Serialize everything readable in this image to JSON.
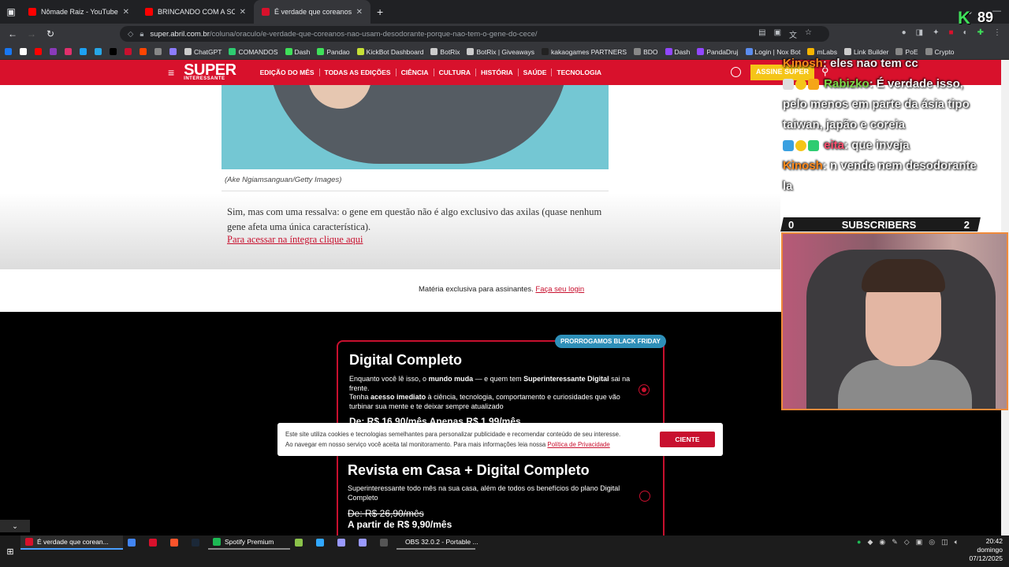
{
  "browser": {
    "tabs": [
      {
        "title": "Nômade Raiz - YouTube",
        "color": "#ff0000"
      },
      {
        "title": "BRINCANDO COM A SORTE N",
        "color": "#ff0000"
      },
      {
        "title": "É verdade que coreanos não us",
        "color": "#d8112c"
      }
    ],
    "url_domain": "super.abril.com.br",
    "url_path": "/coluna/oraculo/e-verdade-que-coreanos-nao-usam-desodorante-porque-nao-tem-o-gene-do-cece/",
    "bookmarks": [
      {
        "label": "",
        "color": "#1877f2"
      },
      {
        "label": "",
        "color": "#ffffff"
      },
      {
        "label": "",
        "color": "#ff0000"
      },
      {
        "label": "",
        "color": "#8a3ab9"
      },
      {
        "label": "",
        "color": "#e1306c"
      },
      {
        "label": "",
        "color": "#1da1f2"
      },
      {
        "label": "",
        "color": "#27a7e7"
      },
      {
        "label": "",
        "color": "#000000"
      },
      {
        "label": "",
        "color": "#c8102e"
      },
      {
        "label": "",
        "color": "#ff4500"
      },
      {
        "label": "",
        "color": "#888888"
      },
      {
        "label": "",
        "color": "#8c7cff"
      },
      {
        "label": "ChatGPT",
        "color": "#cccccc"
      },
      {
        "label": "COMANDOS",
        "color": "#2ecc71"
      },
      {
        "label": "Dash",
        "color": "#3fe05a"
      },
      {
        "label": "Pandao",
        "color": "#3fe05a"
      },
      {
        "label": "KickBot Dashboard",
        "color": "#c6e036"
      },
      {
        "label": "BotRix",
        "color": "#cccccc"
      },
      {
        "label": "BotRix | Giveaways",
        "color": "#cccccc"
      },
      {
        "label": "kakaogames PARTNERS",
        "color": "#222222"
      },
      {
        "label": "BDO",
        "color": "#888888"
      },
      {
        "label": "Dash",
        "color": "#9147ff"
      },
      {
        "label": "PandaDruj",
        "color": "#9147ff"
      },
      {
        "label": "Login | Nox Bot",
        "color": "#5b8def"
      },
      {
        "label": "mLabs",
        "color": "#f7b500"
      },
      {
        "label": "Link Builder",
        "color": "#cccccc"
      },
      {
        "label": "PoE",
        "color": "#888888"
      },
      {
        "label": "Crypto",
        "color": "#888888"
      }
    ]
  },
  "site": {
    "logo": "SUPER",
    "logo_sub": "INTERESSANTE",
    "menu": [
      "EDIÇÃO DO MÊS",
      "TODAS AS EDIÇÕES",
      "CIÊNCIA",
      "CULTURA",
      "HISTÓRIA",
      "SAÚDE",
      "TECNOLOGIA"
    ],
    "cta": "ASSINE SUPER"
  },
  "article": {
    "caption": "(Ake Ngiamsanguan/Getty Images)",
    "body": "Sim, mas com uma ressalva: o gene em questão não é algo exclusivo das axilas (quase nenhum gene afeta uma única característica).",
    "link": "Para acessar na íntegra clique aqui",
    "exclusive_text": "Matéria exclusiva para assinantes.",
    "login_link": "Faça seu login"
  },
  "paywall": {
    "badge": "PRORROGAMOS BLACK FRIDAY",
    "plan1": {
      "title": "Digital Completo",
      "line1_a": "Enquanto você lê isso, o ",
      "line1_b": "mundo muda",
      "line1_c": " — e quem tem ",
      "line1_d": "Superinteressante Digital",
      "line1_e": " sai na frente.",
      "line2_a": "Tenha ",
      "line2_b": "acesso imediato",
      "line2_c": " à ciência, tecnologia, comportamento e curiosidades que vão turbinar sua mente e te deixar sempre atualizado",
      "price": "De: R$ 16,90/mês Apenas R$ 1,99/mês",
      "selected": true
    },
    "plan2": {
      "title": "Revista em Casa + Digital Completo",
      "desc": "Superinteressante todo mês na sua casa, além de todos os benefícios do plano Digital Completo",
      "price_old": "De: R$ 26,90/mês",
      "price_new": "A partir de R$ 9,90/mês",
      "selected": false
    }
  },
  "cookie": {
    "text1": "Este site utiliza cookies e tecnologias semelhantes para personalizar publicidade e recomendar conteúdo de seu interesse.",
    "text2": "Ao navegar em nosso serviço você aceita tal monitoramento. Para mais informações leia nossa ",
    "policy_link": "Política de Privacidade",
    "button": "CIENTE"
  },
  "stream": {
    "chat": [
      {
        "name": "Kinosh",
        "msg": ": eles nao tem cc"
      },
      {
        "name": "Rabizko",
        "msg": ": É verdade isso, pelo menos em parte da ásia tipo taiwan, japão e coreia"
      },
      {
        "name": "eita",
        "msg": ": que inveja"
      },
      {
        "name": "Kinosh",
        "msg": ": n vende nem desodorante la"
      }
    ],
    "subs_left": "0",
    "subs_label": "SUBSCRIBERS",
    "subs_right": "2",
    "overlay_k": "K",
    "overlay_num": "89"
  },
  "taskbar": {
    "apps": [
      {
        "label": "É verdade que corean...",
        "color": "#d8112c"
      },
      {
        "label": "",
        "color": "#4285f4"
      },
      {
        "label": "",
        "color": "#d8112c"
      },
      {
        "label": "",
        "color": "#fb542b"
      },
      {
        "label": "",
        "color": "#1b2838"
      },
      {
        "label": "Spotify Premium",
        "color": "#1db954"
      },
      {
        "label": "",
        "color": "#8bc34a"
      },
      {
        "label": "",
        "color": "#31a8ff"
      },
      {
        "label": "",
        "color": "#9999ff"
      },
      {
        "label": "",
        "color": "#9999ff"
      },
      {
        "label": "",
        "color": "#555555"
      },
      {
        "label": "OBS 32.0.2 - Portable ...",
        "color": "#333333"
      }
    ],
    "time": "20:42",
    "day": "domingo",
    "date": "07/12/2025"
  }
}
